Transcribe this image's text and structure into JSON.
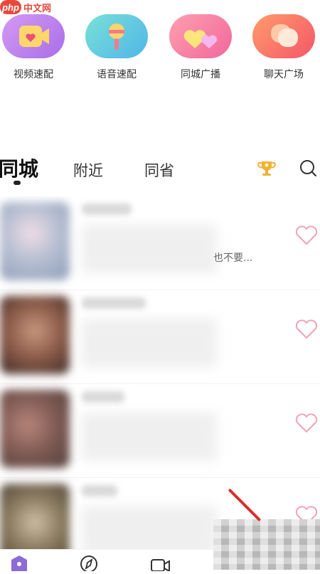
{
  "watermark": {
    "logo": "php",
    "text": "中文网"
  },
  "quick_entries": [
    {
      "label": "视频速配",
      "icon": "video-match-icon"
    },
    {
      "label": "语音速配",
      "icon": "microphone-icon"
    },
    {
      "label": "同城广播",
      "icon": "hearts-broadcast-icon"
    },
    {
      "label": "聊天广场",
      "icon": "chat-bubbles-icon"
    }
  ],
  "tabs": [
    {
      "label": "同城",
      "active": true
    },
    {
      "label": "附近",
      "active": false
    },
    {
      "label": "同省",
      "active": false
    }
  ],
  "header_icons": {
    "rank": "trophy-icon",
    "search": "search-icon"
  },
  "feed": [
    {
      "preview": "也不要...",
      "like_icon": "heart-outline-icon"
    },
    {
      "preview": "",
      "like_icon": "heart-outline-icon"
    },
    {
      "preview": "",
      "like_icon": "heart-outline-icon"
    },
    {
      "preview": "",
      "like_icon": "heart-outline-icon"
    }
  ],
  "bottom_nav": [
    {
      "icon": "home-icon",
      "active": true
    },
    {
      "icon": "compass-icon",
      "active": false
    },
    {
      "icon": "video-camera-icon",
      "active": false
    }
  ],
  "colors": {
    "accent_pink": "#f0a3b5",
    "nav_active": "#8a6bd8",
    "watermark_red": "#e8483b",
    "trophy_gold": "#f2b135"
  }
}
